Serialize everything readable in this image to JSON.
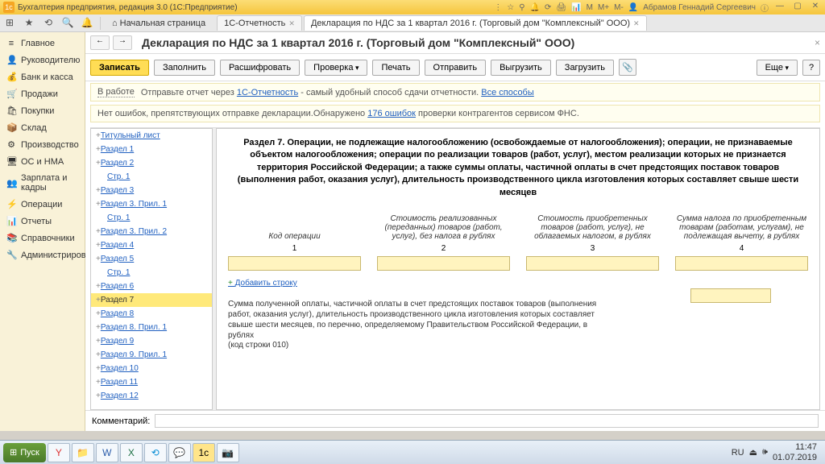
{
  "titlebar": {
    "app_icon": "1c",
    "title": "Бухгалтерия предприятия, редакция 3.0 (1С:Предприятие)",
    "user": "Абрамов Геннадий Сергеевич"
  },
  "top_toolbar": {
    "home": "Начальная страница"
  },
  "tabs": [
    {
      "label": "1С-Отчетность"
    },
    {
      "label": "Декларация по НДС за 1 квартал 2016 г. (Торговый дом \"Комплексный\" ООО)"
    }
  ],
  "sidebar": {
    "items": [
      {
        "icon": "≡",
        "label": "Главное"
      },
      {
        "icon": "👤",
        "label": "Руководителю"
      },
      {
        "icon": "💰",
        "label": "Банк и касса"
      },
      {
        "icon": "🛒",
        "label": "Продажи"
      },
      {
        "icon": "🛍",
        "label": "Покупки"
      },
      {
        "icon": "📦",
        "label": "Склад"
      },
      {
        "icon": "⚙",
        "label": "Производство"
      },
      {
        "icon": "🖥",
        "label": "ОС и НМА"
      },
      {
        "icon": "👥",
        "label": "Зарплата и кадры"
      },
      {
        "icon": "⚡",
        "label": "Операции"
      },
      {
        "icon": "📊",
        "label": "Отчеты"
      },
      {
        "icon": "📚",
        "label": "Справочники"
      },
      {
        "icon": "🔧",
        "label": "Администрирование"
      }
    ]
  },
  "page": {
    "title": "Декларация по НДС за 1 квартал 2016 г. (Торговый дом \"Комплексный\" ООО)"
  },
  "toolbar": {
    "write": "Записать",
    "fill": "Заполнить",
    "decode": "Расшифровать",
    "check": "Проверка",
    "print": "Печать",
    "send": "Отправить",
    "export": "Выгрузить",
    "import": "Загрузить",
    "more": "Еще"
  },
  "info": {
    "status": "В работе",
    "text1": "Отправьте отчет через ",
    "link1": "1С-Отчетность",
    "text2": " - самый удобный способ сдачи отчетности. ",
    "link2": "Все способы"
  },
  "warn": {
    "text1": "Нет ошибок, препятствующих отправке декларации.Обнаружено ",
    "link": "176 ошибок",
    "text2": " проверки контрагентов сервисом ФНС."
  },
  "sections": [
    {
      "label": "Титульный лист",
      "indent": false
    },
    {
      "label": "Раздел 1",
      "indent": false
    },
    {
      "label": "Раздел 2",
      "indent": false
    },
    {
      "label": "Стр. 1",
      "indent": true
    },
    {
      "label": "Раздел 3",
      "indent": false
    },
    {
      "label": "Раздел 3. Прил. 1",
      "indent": false
    },
    {
      "label": "Стр. 1",
      "indent": true
    },
    {
      "label": "Раздел 3. Прил. 2",
      "indent": false
    },
    {
      "label": "Раздел 4",
      "indent": false
    },
    {
      "label": "Раздел 5",
      "indent": false
    },
    {
      "label": "Стр. 1",
      "indent": true
    },
    {
      "label": "Раздел 6",
      "indent": false
    },
    {
      "label": "Раздел 7",
      "indent": false,
      "selected": true
    },
    {
      "label": "Раздел 8",
      "indent": false
    },
    {
      "label": "Раздел 8. Прил. 1",
      "indent": false
    },
    {
      "label": "Раздел 9",
      "indent": false
    },
    {
      "label": "Раздел 9. Прил. 1",
      "indent": false
    },
    {
      "label": "Раздел 10",
      "indent": false
    },
    {
      "label": "Раздел 11",
      "indent": false
    },
    {
      "label": "Раздел 12",
      "indent": false
    }
  ],
  "preview": {
    "heading": "Раздел 7. Операции, не подлежащие налогообложению (освобождаемые от налогообложения); операции, не признаваемые объектом налогообложения; операции по реализации товаров (работ, услуг), местом реализации которых не признается территория Российской Федерации; а также суммы оплаты, частичной оплаты в счет предстоящих поставок товаров (выполнения работ, оказания услуг), длительность производственного цикла изготовления которых составляет свыше шести месяцев",
    "cols": [
      {
        "head": "Код операции",
        "num": "1"
      },
      {
        "head": "Стоимость реализованных (переданных) товаров (работ, услуг), без налога в рублях",
        "num": "2"
      },
      {
        "head": "Стоимость приобретенных товаров (работ, услуг), не облагаемых налогом, в рублях",
        "num": "3"
      },
      {
        "head": "Сумма налога по приобретенным товарам (работам, услугам), не подлежащая вычету, в рублях",
        "num": "4"
      }
    ],
    "add_row": "Добавить строку",
    "paragraph": "Сумма полученной оплаты, частичной оплаты в счет предстоящих поставок товаров (выполнения работ, оказания услуг), длительность производственного цикла изготовления которых составляет свыше шести месяцев, по перечню, определяемому Правительством Российской Федерации, в рублях",
    "code_line": "(код строки 010)"
  },
  "comment": {
    "label": "Комментарий:",
    "placeholder": ""
  },
  "taskbar": {
    "start": "Пуск",
    "lang": "RU",
    "time": "11:47",
    "date": "01.07.2019"
  }
}
